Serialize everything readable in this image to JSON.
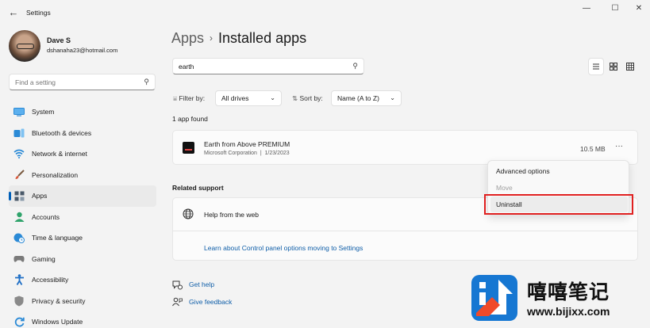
{
  "window": {
    "title": "Settings",
    "controls": {
      "minimize": "—",
      "maximize": "☐",
      "close": "✕"
    }
  },
  "profile": {
    "name": "Dave S",
    "email": "dshanaha23@hotmail.com"
  },
  "sidebar": {
    "search_placeholder": "Find a setting",
    "items": [
      {
        "label": "System",
        "icon": "system-icon",
        "color": "#2b8ad6"
      },
      {
        "label": "Bluetooth & devices",
        "icon": "bluetooth-icon",
        "color": "#2b8ad6"
      },
      {
        "label": "Network & internet",
        "icon": "wifi-icon",
        "color": "#2b8ad6"
      },
      {
        "label": "Personalization",
        "icon": "brush-icon",
        "color": "#d9573a"
      },
      {
        "label": "Apps",
        "icon": "apps-icon",
        "color": "#5a6a7a",
        "active": true
      },
      {
        "label": "Accounts",
        "icon": "person-icon",
        "color": "#2fa36b"
      },
      {
        "label": "Time & language",
        "icon": "clock-globe-icon",
        "color": "#2b8ad6"
      },
      {
        "label": "Gaming",
        "icon": "gamepad-icon",
        "color": "#7a7a7a"
      },
      {
        "label": "Accessibility",
        "icon": "accessibility-icon",
        "color": "#1f6fc5"
      },
      {
        "label": "Privacy & security",
        "icon": "shield-icon",
        "color": "#7a7a7a"
      },
      {
        "label": "Windows Update",
        "icon": "update-icon",
        "color": "#2b8ad6"
      }
    ]
  },
  "breadcrumb": {
    "parent": "Apps",
    "separator": "›",
    "current": "Installed apps"
  },
  "app_search": {
    "value": "earth"
  },
  "filters": {
    "filter_label": "Filter by:",
    "filter_value": "All drives",
    "sort_label": "Sort by:",
    "sort_value": "Name (A to Z)"
  },
  "results": {
    "count_text": "1 app found"
  },
  "app": {
    "name": "Earth from Above PREMIUM",
    "publisher": "Microsoft Corporation",
    "separator": "|",
    "date": "1/23/2023",
    "size": "10.5 MB",
    "more": "···"
  },
  "context_menu": {
    "items": [
      {
        "label": "Advanced options",
        "state": "normal"
      },
      {
        "label": "Move",
        "state": "disabled"
      },
      {
        "label": "Uninstall",
        "state": "hover"
      }
    ],
    "highlight_color": "#e02020"
  },
  "related_support": {
    "heading": "Related support",
    "help_item": "Help from the web",
    "link": "Learn about Control panel options moving to Settings"
  },
  "footer_links": {
    "get_help": "Get help",
    "give_feedback": "Give feedback"
  },
  "watermark": {
    "text": "嘻嘻笔记",
    "url": "www.bijixx.com"
  },
  "accent_color": "#005fb8",
  "link_color": "#0f5ea8"
}
